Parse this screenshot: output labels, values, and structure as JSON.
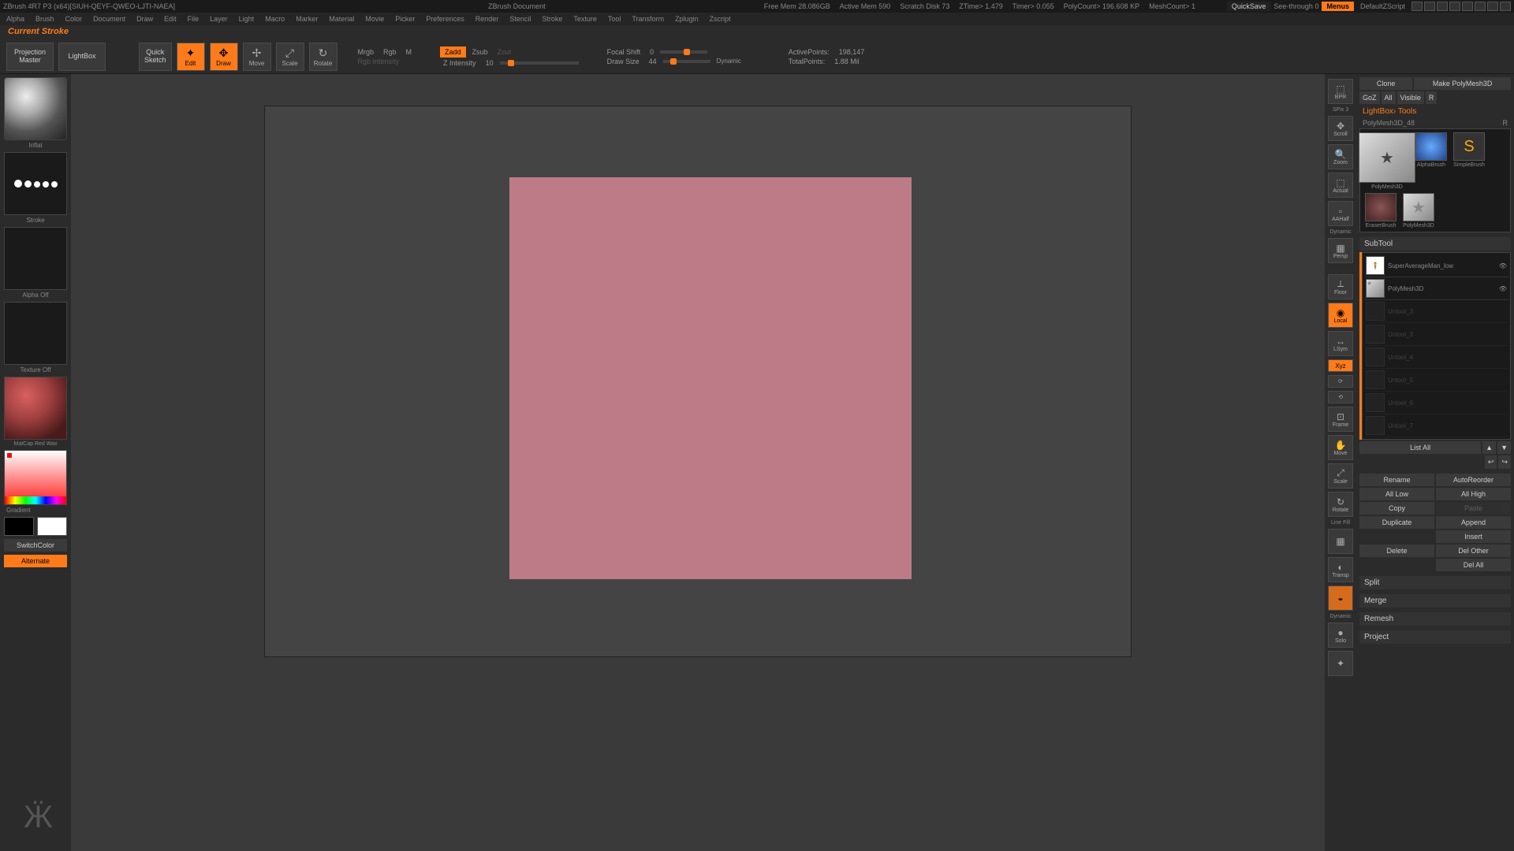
{
  "titlebar": {
    "app": "ZBrush 4R7 P3  (x64)[SIUH-QEYF-QWEO-LJTI-NAEA]",
    "doc": "ZBrush Document",
    "stats": {
      "freemem": "Free Mem  28.086GB",
      "activemem": "Active Mem  590",
      "scratch": "Scratch Disk  73",
      "ztime": "ZTime>  1.479",
      "timer": "Timer>  0.055",
      "polycount": "PolyCount>  196.608 KP",
      "meshcount": "MeshCount>  1"
    },
    "quicksave": "QuickSave",
    "seethrough": "See-through   0",
    "menus": "Menus",
    "defaultscript": "DefaultZScript"
  },
  "menubar": [
    "Alpha",
    "Brush",
    "Color",
    "Document",
    "Draw",
    "Edit",
    "File",
    "Layer",
    "Light",
    "Macro",
    "Marker",
    "Material",
    "Movie",
    "Picker",
    "Preferences",
    "Render",
    "Stencil",
    "Stroke",
    "Texture",
    "Tool",
    "Transform",
    "Zplugin",
    "Zscript"
  ],
  "infoline": "Current Stroke",
  "toolbar": {
    "projection": "Projection\nMaster",
    "lightbox": "LightBox",
    "quicksketch": "Quick\nSketch",
    "edit": "Edit",
    "draw": "Draw",
    "move": "Move",
    "scale": "Scale",
    "rotate": "Rotate",
    "mrgb": "Mrgb",
    "rgb": "Rgb",
    "m": "M",
    "rgbintensity": "Rgb Intensity",
    "zadd": "Zadd",
    "zsub": "Zsub",
    "zcut": "Zcut",
    "zintensity_label": "Z Intensity",
    "zintensity_val": "10",
    "focalshift_label": "Focal Shift",
    "focalshift_val": "0",
    "drawsize_label": "Draw Size",
    "drawsize_val": "44",
    "dynamic": "Dynamic",
    "activepoints_label": "ActivePoints:",
    "activepoints_val": "198,147",
    "totalpoints_label": "TotalPoints:",
    "totalpoints_val": "1.88 Mil"
  },
  "leftpanel": {
    "brush": "Inflat",
    "stroke": "Stroke",
    "alpha": "Alpha  Off",
    "texture": "Texture  Off",
    "material": "MatCap Red Wax",
    "gradient": "Gradient",
    "switchcolor": "SwitchColor",
    "alternate": "Alternate"
  },
  "vstrip": {
    "bpr": "BPR",
    "spix": "SPix 3",
    "scroll": "Scroll",
    "zoom": "Zoom",
    "actual": "Actual",
    "aahalf": "AAHalf",
    "persp": "Persp",
    "floor": "Floor",
    "local": "Local",
    "lsym": "LSym",
    "xyz": "Xyz",
    "frame": "Frame",
    "move": "Move",
    "scale": "Scale",
    "rotate": "Rotate",
    "linefill": "Line Fill",
    "transp": "Transp",
    "dynamic2": "Dynamic",
    "solo": "Solo"
  },
  "rightpanel": {
    "clone": "Clone",
    "makepoly": "Make PolyMesh3D",
    "goz": "GoZ",
    "all": "All",
    "visible": "Visible",
    "r": "R",
    "lightbox_tools": "LightBox› Tools",
    "toolname": "PolyMesh3D_48",
    "tool_r": "R",
    "tools": [
      {
        "label": "PolyMesh3D"
      },
      {
        "label": "AlphaBrush"
      },
      {
        "label": "SimpleBrush"
      },
      {
        "label": "EraserBrush"
      },
      {
        "label": "PolyMesh3D"
      }
    ],
    "subtool_head": "SubTool",
    "subtools": [
      {
        "name": "SuperAverageMan_low",
        "active": true
      },
      {
        "name": "PolyMesh3D",
        "active": true
      },
      {
        "name": "Untool_3",
        "active": false
      },
      {
        "name": "Untool_3",
        "active": false
      },
      {
        "name": "Untool_4",
        "active": false
      },
      {
        "name": "Untool_5",
        "active": false
      },
      {
        "name": "Untool_6",
        "active": false
      },
      {
        "name": "Untool_7",
        "active": false
      }
    ],
    "listall": "List All",
    "buttons": {
      "rename": "Rename",
      "autoreorder": "AutoReorder",
      "alllow": "All Low",
      "allhigh": "All High",
      "copy": "Copy",
      "paste": "Paste",
      "duplicate": "Duplicate",
      "append": "Append",
      "insert": "Insert",
      "delete": "Delete",
      "delother": "Del Other",
      "delall": "Del All",
      "split": "Split",
      "merge": "Merge",
      "remesh": "Remesh",
      "project": "Project"
    }
  }
}
